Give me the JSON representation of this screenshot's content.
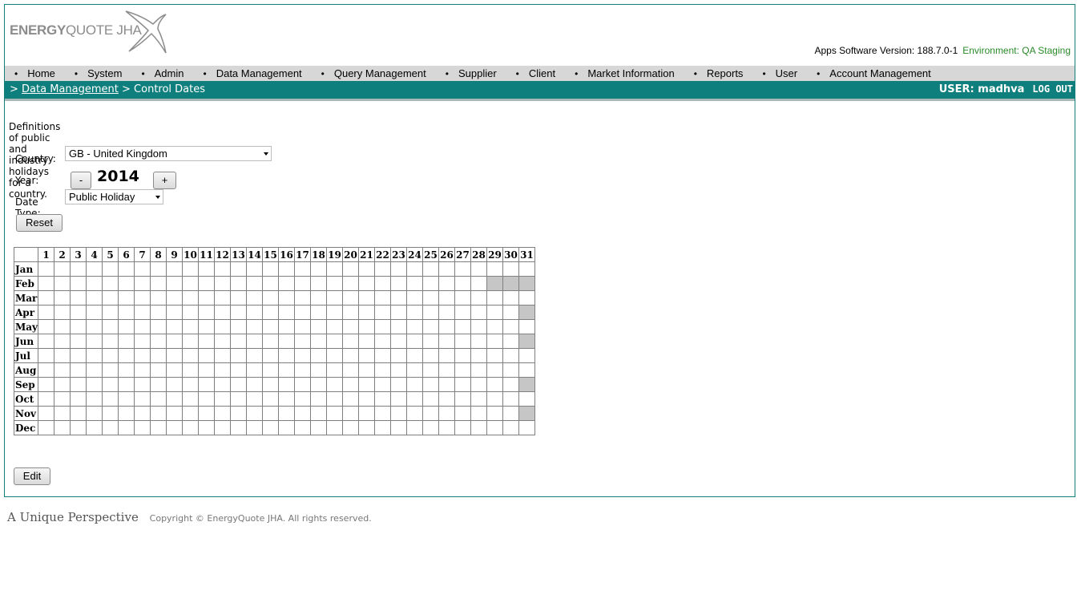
{
  "header": {
    "logo_text_bold": "ENERGY",
    "logo_text_rest": "QUOTE JHA",
    "version_label": "Apps Software Version: 188.7.0-1",
    "environment_label": "Environment: QA Staging"
  },
  "menu": [
    {
      "label": "Home"
    },
    {
      "label": "System"
    },
    {
      "label": "Admin"
    },
    {
      "label": "Data Management"
    },
    {
      "label": "Query Management"
    },
    {
      "label": "Supplier"
    },
    {
      "label": "Client"
    },
    {
      "label": "Market Information"
    },
    {
      "label": "Reports"
    },
    {
      "label": "User"
    },
    {
      "label": "Account Management"
    }
  ],
  "breadcrumb": {
    "prefix": ">",
    "link": "Data Management",
    "separator": ">",
    "current": "Control Dates"
  },
  "user": {
    "label": "USER: madhva",
    "logout": "LOG OUT"
  },
  "page": {
    "description": "Definitions of public and industry holidays for a country.",
    "country_label": "Country:",
    "country_value": "GB - United Kingdom",
    "year_label": "Year:",
    "year_value": "2014",
    "year_minus": "-",
    "year_plus": "+",
    "date_type_label": "Date Type:",
    "date_type_value": "Public Holiday",
    "reset_label": "Reset",
    "edit_label": "Edit"
  },
  "calendar": {
    "days": [
      "1",
      "2",
      "3",
      "4",
      "5",
      "6",
      "7",
      "8",
      "9",
      "10",
      "11",
      "12",
      "13",
      "14",
      "15",
      "16",
      "17",
      "18",
      "19",
      "20",
      "21",
      "22",
      "23",
      "24",
      "25",
      "26",
      "27",
      "28",
      "29",
      "30",
      "31"
    ],
    "months": [
      "Jan",
      "Feb",
      "Mar",
      "Apr",
      "May",
      "Jun",
      "Jul",
      "Aug",
      "Sep",
      "Oct",
      "Nov",
      "Dec"
    ],
    "disabled_cells": [
      {
        "month": "Feb",
        "day": 29
      },
      {
        "month": "Feb",
        "day": 30
      },
      {
        "month": "Feb",
        "day": 31
      },
      {
        "month": "Apr",
        "day": 31
      },
      {
        "month": "Jun",
        "day": 31
      },
      {
        "month": "Sep",
        "day": 31
      },
      {
        "month": "Nov",
        "day": 31
      }
    ],
    "disabled_color": "#c6c6c6"
  },
  "footer": {
    "tagline": "A Unique Perspective",
    "copyright": "Copyright © EnergyQuote JHA. All rights reserved."
  },
  "colors": {
    "teal": "#0f7f7d",
    "menu_bg": "#d7d7d7",
    "environment": "#2a8a2a"
  }
}
